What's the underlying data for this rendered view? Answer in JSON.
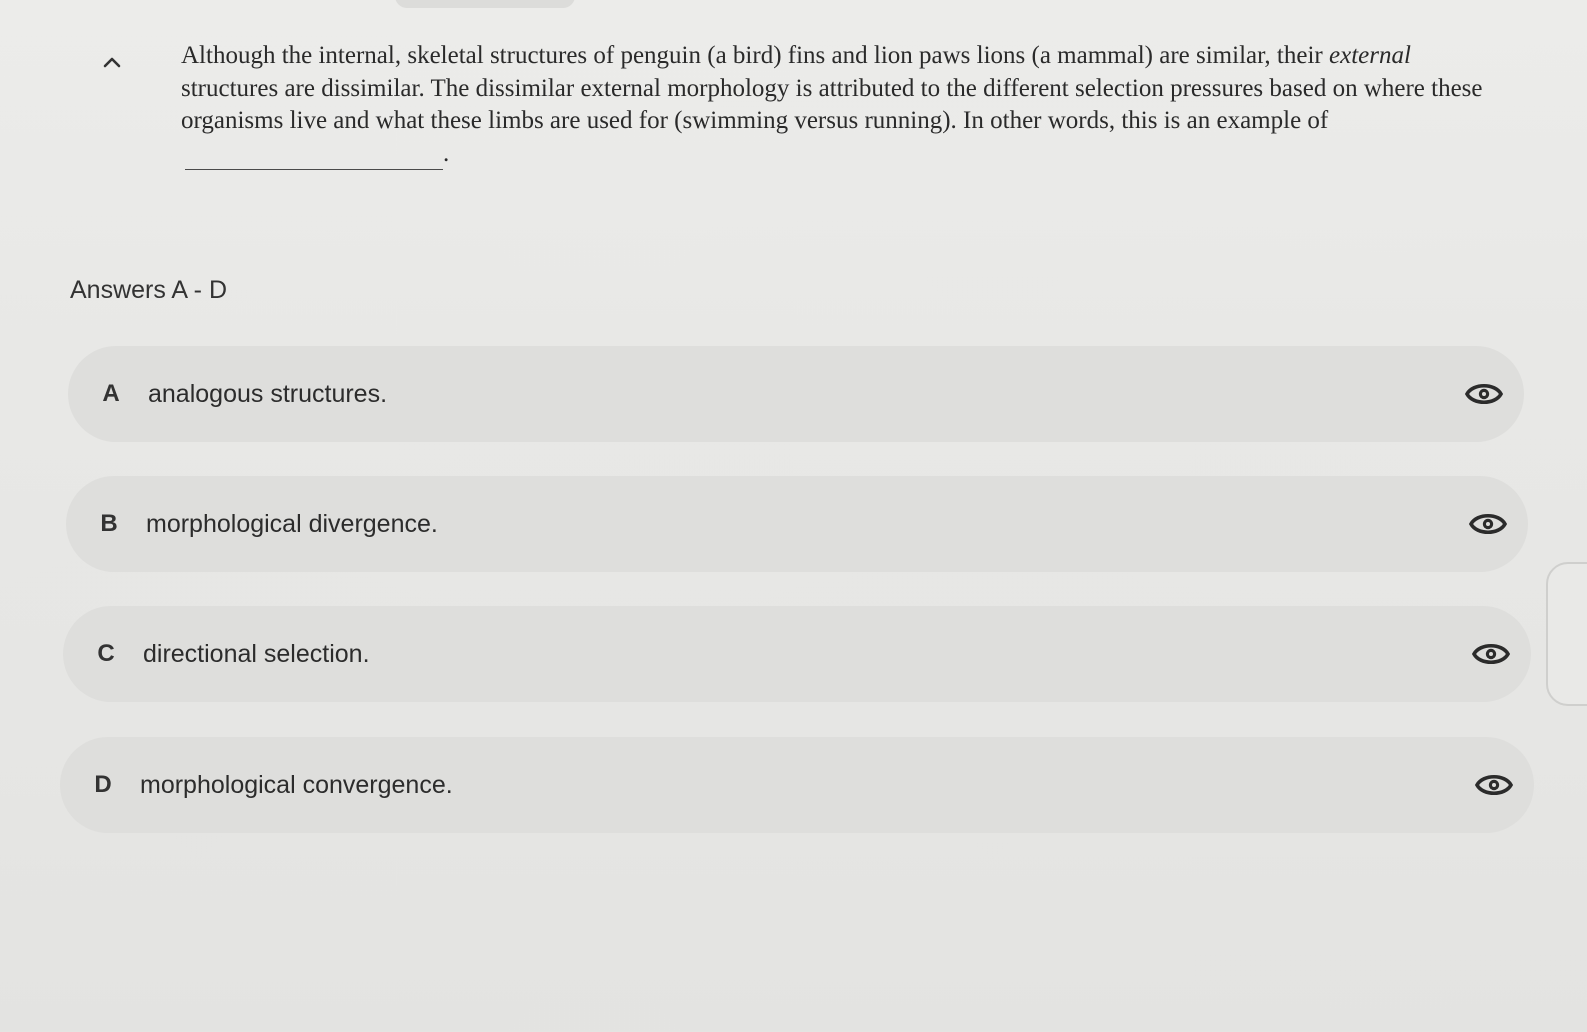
{
  "question": {
    "collapse_icon": "chevron-up-icon",
    "text_before": "Although the internal, skeletal structures of penguin (a bird) fins and lion paws lions (a mammal) are similar, their ",
    "text_emphasis": "external",
    "text_after": " structures are dissimilar. The dissimilar external morphology is attributed to the different selection pressures based on where these organisms live and what these limbs are used for (swimming versus running). In other words, this is an example of",
    "text_end": "."
  },
  "answers": {
    "heading": "Answers A - D",
    "options": [
      {
        "letter": "A",
        "text": "analogous structures.",
        "icon": "eye-icon"
      },
      {
        "letter": "B",
        "text": "morphological divergence.",
        "icon": "eye-icon"
      },
      {
        "letter": "C",
        "text": "directional selection.",
        "icon": "eye-icon"
      },
      {
        "letter": "D",
        "text": "morphological convergence.",
        "icon": "eye-icon"
      }
    ]
  },
  "colors": {
    "background": "#e8e8e6",
    "option_background": "#dededc",
    "text": "#2c2c2c"
  }
}
